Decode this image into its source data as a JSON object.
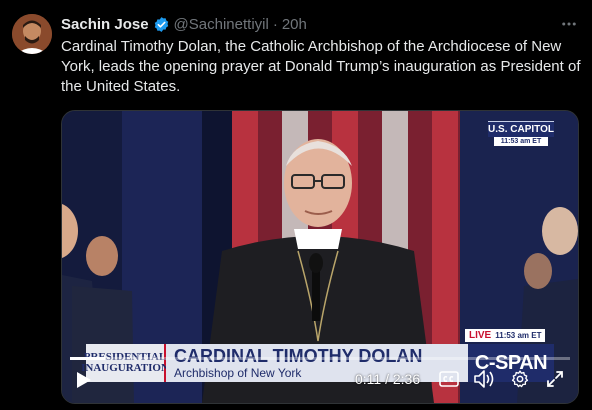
{
  "tweet": {
    "author_name": "Sachin Jose",
    "handle": "@Sachinettiyil",
    "separator": "·",
    "time": "20h",
    "text": "Cardinal Timothy Dolan, the Catholic Archbishop of the Archdiocese of New York, leads the opening prayer at Donald Trump’s inauguration as President of the United States.",
    "verified_color": "#1d9bf0"
  },
  "video": {
    "bug_title": "U.S. CAPITOL",
    "bug_time": "11:53 am ET",
    "live_label": "LIVE",
    "live_time": "11:53 am ET",
    "lower_third": {
      "logo_line1": "PRESIDENTIAL",
      "logo_line2": "INAUGURATION",
      "name": "CARDINAL TIMOTHY DOLAN",
      "subtitle": "Archbishop of New York",
      "brand": "C-SPAN"
    },
    "time_readout": "0:11 / 2:36",
    "progress_fraction": 0.07
  },
  "colors": {
    "background": "#000000",
    "text": "#e7e9ea",
    "muted": "#71767b",
    "cspan_blue": "#1f2c6a",
    "cspan_red": "#c8102e"
  }
}
